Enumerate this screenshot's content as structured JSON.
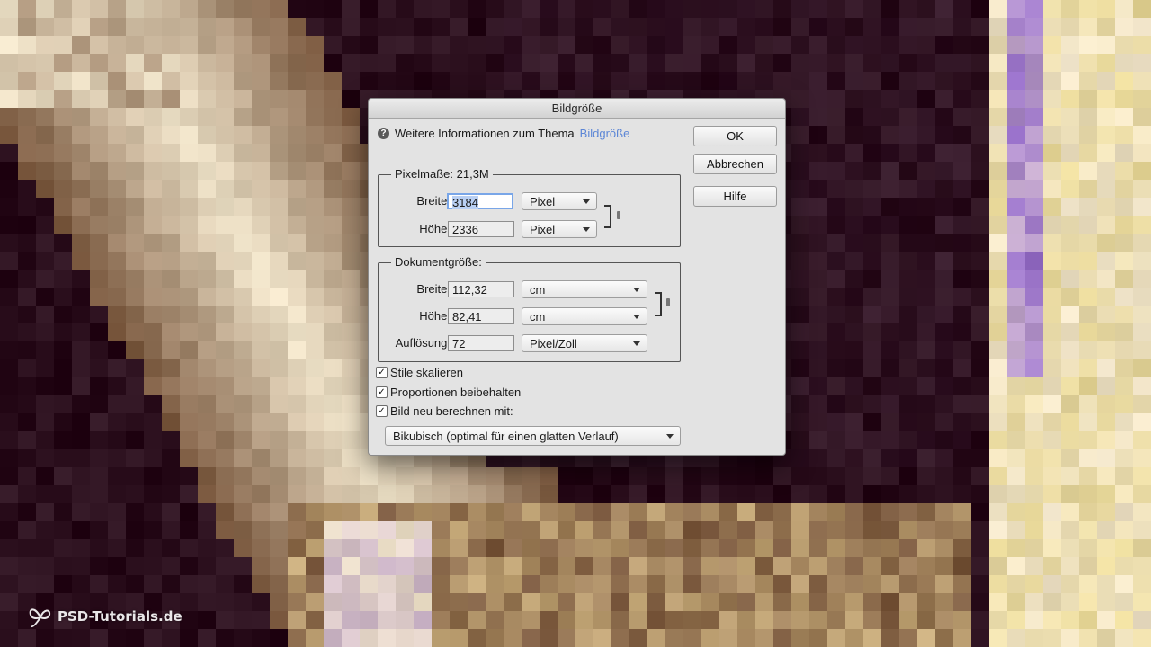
{
  "watermark": {
    "text": "PSD-Tutorials.de"
  },
  "dialog": {
    "title": "Bildgröße",
    "info_prefix": "Weitere Informationen zum Thema",
    "info_link": "Bildgröße",
    "buttons": {
      "ok": "OK",
      "cancel": "Abbrechen",
      "help": "Hilfe"
    },
    "pixel_dimensions": {
      "legend": "Pixelmaße: 21,3M",
      "width_label": "Breite:",
      "width_value": "3184",
      "width_unit": "Pixel",
      "height_label": "Höhe:",
      "height_value": "2336",
      "height_unit": "Pixel"
    },
    "document_size": {
      "legend": "Dokumentgröße:",
      "width_label": "Breite:",
      "width_value": "112,32",
      "width_unit": "cm",
      "height_label": "Höhe:",
      "height_value": "82,41",
      "height_unit": "cm",
      "resolution_label": "Auflösung:",
      "resolution_value": "72",
      "resolution_unit": "Pixel/Zoll"
    },
    "options": {
      "scale_styles": {
        "label": "Stile skalieren",
        "checked": true
      },
      "constrain": {
        "label": "Proportionen beibehalten",
        "checked": true
      },
      "resample": {
        "label": "Bild neu berechnen mit:",
        "checked": true
      },
      "resample_method": "Bikubisch (optimal für einen glatten Verlauf)"
    }
  }
}
